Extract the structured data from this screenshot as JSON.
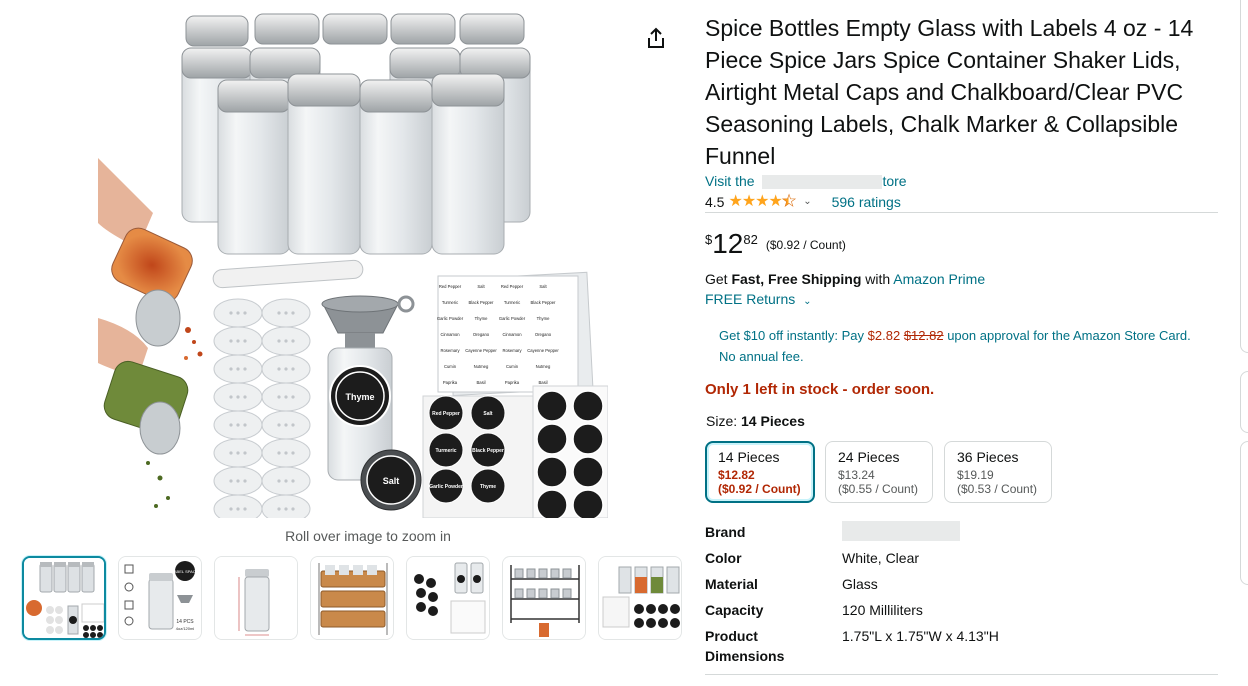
{
  "gallery": {
    "zoom_hint": "Roll over image to zoom in",
    "main_image_icon": "spice-jars-product-photo",
    "main_image_texts": {
      "marker": "",
      "funnel_jar_label": "Thyme",
      "lid_label": "Salt",
      "label_sheet_words": [
        "Red Pepper",
        "Salt",
        "Red Pepper",
        "Salt",
        "Turmeric",
        "Black Pepper",
        "Turmeric",
        "Black Pepper",
        "Garlic Powder",
        "Thyme",
        "Garlic Powder",
        "Thyme",
        "Cinnamon",
        "Oregano",
        "Cinnamon",
        "Oregano",
        "Rosemary",
        "Cayenne Pepper",
        "Rosemary",
        "Cayenne Pepper",
        "Cumin",
        "Nutmeg",
        "Cumin",
        "Nutmeg",
        "Paprika",
        "Basil",
        "Paprika",
        "Basil"
      ],
      "chalk_labels": [
        "Red Pepper",
        "Salt",
        "Turmeric",
        "Black Pepper",
        "Garlic Powder",
        "Thyme"
      ]
    },
    "thumbnails": [
      {
        "icon": "spice-jars-set-thumbnail"
      },
      {
        "icon": "jar-features-thumbnail"
      },
      {
        "icon": "single-jar-dimensions-thumbnail"
      },
      {
        "icon": "jars-in-rack-thumbnail"
      },
      {
        "icon": "labels-and-jars-thumbnail"
      },
      {
        "icon": "wire-rack-thumbnail"
      },
      {
        "icon": "spice-jars-with-labels-thumbnail"
      }
    ],
    "thumb2_texts": {
      "jar_label": "LABEL SPACE",
      "caption_1": "14 PCS",
      "caption_2": "4oz/120ml"
    },
    "share_icon": "share-icon"
  },
  "product": {
    "title": "Spice Bottles Empty Glass with Labels 4 oz - 14 Piece Spice Jars Spice Container Shaker Lids, Airtight Metal Caps and Chalkboard/Clear PVC Seasoning Labels, Chalk Marker & Collapsible Funnel",
    "store_prefix": "Visit the",
    "store_suffix": "tore",
    "rating_value": "4.5",
    "rating_stars": 4.5,
    "ratings_count": "596 ratings",
    "price": {
      "symbol": "$",
      "whole": "12",
      "fraction": "82",
      "unit": "($0.92 / Count)"
    },
    "shipping": {
      "prefix": "Get",
      "fast": "Fast, Free Shipping",
      "with": "with",
      "prime": "Amazon Prime",
      "returns": "FREE Returns",
      "returns_chevron": "chevron-down-icon"
    },
    "card_offer": {
      "lead": "Get $10 off instantly: Pay",
      "new_price": "$2.82",
      "old_price": "$12.82",
      "tail": "upon approval for the Amazon Store Card. No annual fee."
    },
    "stock": "Only 1 left in stock - order soon.",
    "size": {
      "label": "Size:",
      "selected": "14 Pieces",
      "options": [
        {
          "name": "14 Pieces",
          "price": "$12.82",
          "unit": "($0.92 / Count)",
          "selected": true
        },
        {
          "name": "24 Pieces",
          "price": "$13.24",
          "unit": "($0.55 / Count)",
          "selected": false
        },
        {
          "name": "36 Pieces",
          "price": "$19.19",
          "unit": "($0.53 / Count)",
          "selected": false
        }
      ]
    },
    "specs": [
      {
        "key": "Brand",
        "value": ""
      },
      {
        "key": "Color",
        "value": "White, Clear"
      },
      {
        "key": "Material",
        "value": "Glass"
      },
      {
        "key": "Capacity",
        "value": "120 Milliliters"
      },
      {
        "key": "Product Dimensions",
        "value": "1.75\"L x 1.75\"W x 4.13\"H"
      }
    ]
  },
  "colors": {
    "link": "#007185",
    "price_red": "#b12704",
    "star": "#ffa41c",
    "selected_border": "#007185"
  }
}
